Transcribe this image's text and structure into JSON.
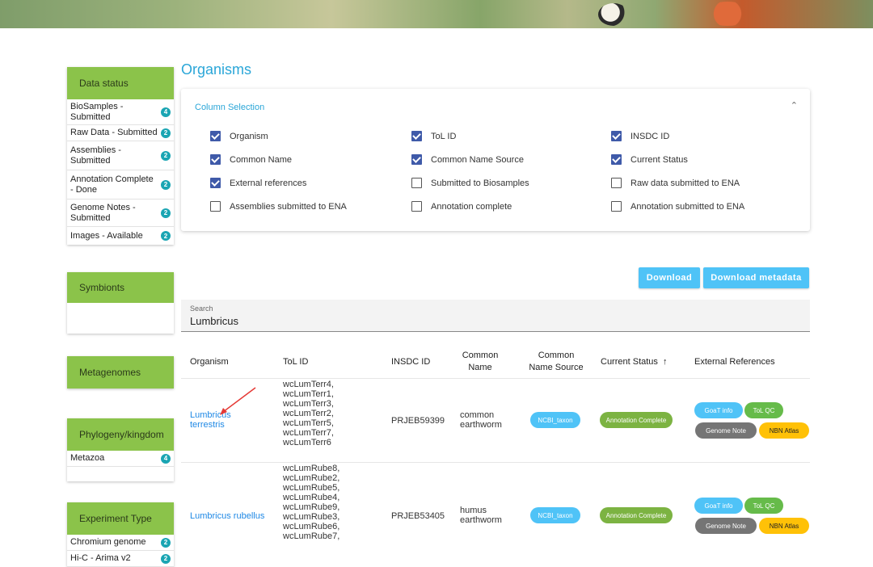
{
  "page": {
    "title": "Organisms"
  },
  "sidebar": {
    "data_status": {
      "title": "Data status",
      "items": [
        {
          "label": "BioSamples - Submitted",
          "count": "4"
        },
        {
          "label": "Raw Data - Submitted",
          "count": "2"
        },
        {
          "label": "Assemblies - Submitted",
          "count": "2"
        },
        {
          "label": "Annotation Complete - Done",
          "count": "2"
        },
        {
          "label": "Genome Notes - Submitted",
          "count": "2"
        },
        {
          "label": "Images - Available",
          "count": "2"
        }
      ]
    },
    "symbionts": {
      "title": "Symbionts"
    },
    "metagenomes": {
      "title": "Metagenomes"
    },
    "phylogeny": {
      "title": "Phylogeny/kingdom",
      "items": [
        {
          "label": "Metazoa",
          "count": "4"
        }
      ]
    },
    "experiment": {
      "title": "Experiment Type",
      "items": [
        {
          "label": "Chromium genome",
          "count": "2"
        },
        {
          "label": "Hi-C - Arima v2",
          "count": "2"
        }
      ]
    }
  },
  "column_selection": {
    "title": "Column Selection",
    "options": [
      {
        "label": "Organism",
        "checked": true
      },
      {
        "label": "ToL ID",
        "checked": true
      },
      {
        "label": "INSDC ID",
        "checked": true
      },
      {
        "label": "Common Name",
        "checked": true
      },
      {
        "label": "Common Name Source",
        "checked": true
      },
      {
        "label": "Current Status",
        "checked": true
      },
      {
        "label": "External references",
        "checked": true
      },
      {
        "label": "Submitted to Biosamples",
        "checked": false
      },
      {
        "label": "Raw data submitted to ENA",
        "checked": false
      },
      {
        "label": "Assemblies submitted to ENA",
        "checked": false
      },
      {
        "label": "Annotation complete",
        "checked": false
      },
      {
        "label": "Annotation submitted to ENA",
        "checked": false
      }
    ]
  },
  "toolbar": {
    "download": "Download",
    "download_metadata": "Download metadata"
  },
  "search": {
    "label": "Search",
    "value": "Lumbricus"
  },
  "table": {
    "headers": {
      "organism": "Organism",
      "tol_id": "ToL ID",
      "insdc": "INSDC ID",
      "common_name_1": "Common",
      "common_name_2": "Name",
      "cns_1": "Common",
      "cns_2": "Name Source",
      "status": "Current Status",
      "ext": "External References"
    },
    "rows": [
      {
        "organism_1": "Lumbricus",
        "organism_2": "terrestris",
        "tol_ids": [
          "wcLumTerr4,",
          "wcLumTerr1,",
          "wcLumTerr3,",
          "wcLumTerr2,",
          "wcLumTerr5,",
          "wcLumTerr7,",
          "wcLumTerr6"
        ],
        "insdc": "PRJEB59399",
        "common_1": "common",
        "common_2": "earthworm",
        "source": "NCBI_taxon",
        "status": "Annotation Complete",
        "refs": {
          "goat": "GoaT info",
          "tolqc": "ToL QC",
          "note": "Genome Note",
          "nbn": "NBN Atlas"
        }
      },
      {
        "organism_1": "Lumbricus rubellus",
        "tol_ids": [
          "wcLumRube8,",
          "wcLumRube2,",
          "wcLumRube5,",
          "wcLumRube4,",
          "wcLumRube9,",
          "wcLumRube3,",
          "wcLumRube6,",
          "wcLumRube7,"
        ],
        "insdc": "PRJEB53405",
        "common_1": "humus",
        "common_2": "earthworm",
        "source": "NCBI_taxon",
        "status": "Annotation Complete",
        "refs": {
          "goat": "GoaT info",
          "tolqc": "ToL QC",
          "note": "Genome Note",
          "nbn": "NBN Atlas"
        }
      }
    ]
  },
  "colors": {
    "accent": "#2aa6d8",
    "panel_green": "#8bc34a",
    "badge": "#1aa5b3",
    "button": "#4fc3f7"
  }
}
